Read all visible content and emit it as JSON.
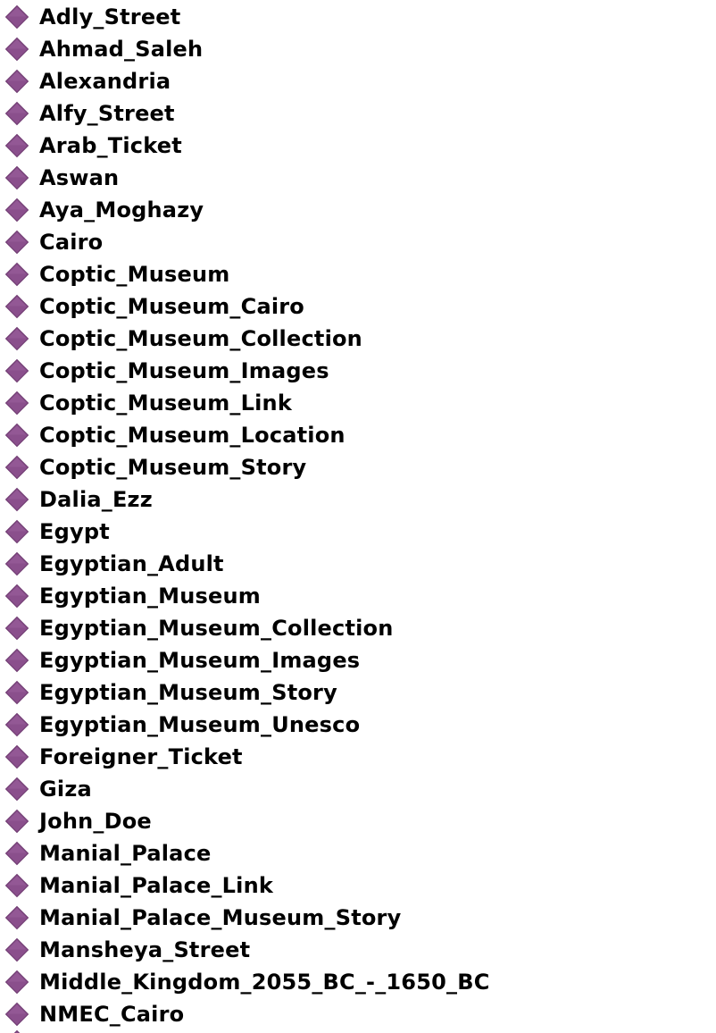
{
  "tree": {
    "icon": "individual-diamond-icon",
    "icon_color": "#8a4f8c",
    "items": [
      {
        "label": "Adly_Street"
      },
      {
        "label": "Ahmad_Saleh"
      },
      {
        "label": "Alexandria"
      },
      {
        "label": "Alfy_Street"
      },
      {
        "label": "Arab_Ticket"
      },
      {
        "label": "Aswan"
      },
      {
        "label": "Aya_Moghazy"
      },
      {
        "label": "Cairo"
      },
      {
        "label": "Coptic_Museum"
      },
      {
        "label": "Coptic_Museum_Cairo"
      },
      {
        "label": "Coptic_Museum_Collection"
      },
      {
        "label": "Coptic_Museum_Images"
      },
      {
        "label": "Coptic_Museum_Link"
      },
      {
        "label": "Coptic_Museum_Location"
      },
      {
        "label": "Coptic_Museum_Story"
      },
      {
        "label": "Dalia_Ezz"
      },
      {
        "label": "Egypt"
      },
      {
        "label": "Egyptian_Adult"
      },
      {
        "label": "Egyptian_Museum"
      },
      {
        "label": "Egyptian_Museum_Collection"
      },
      {
        "label": "Egyptian_Museum_Images"
      },
      {
        "label": "Egyptian_Museum_Story"
      },
      {
        "label": "Egyptian_Museum_Unesco"
      },
      {
        "label": "Foreigner_Ticket"
      },
      {
        "label": "Giza"
      },
      {
        "label": "John_Doe"
      },
      {
        "label": "Manial_Palace"
      },
      {
        "label": "Manial_Palace_Link"
      },
      {
        "label": "Manial_Palace_Museum_Story"
      },
      {
        "label": "Mansheya_Street"
      },
      {
        "label": "Middle_Kingdom_2055_BC_-_1650_BC"
      },
      {
        "label": "NMEC_Cairo"
      }
    ]
  }
}
